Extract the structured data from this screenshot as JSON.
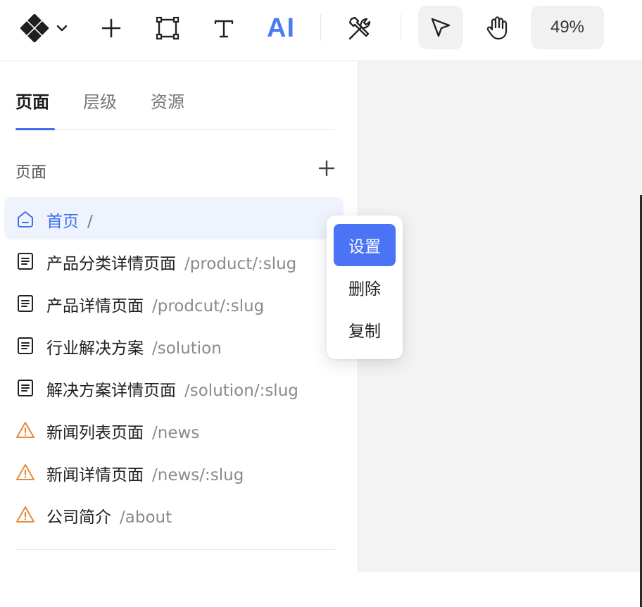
{
  "toolbar": {
    "ai_label": "AI",
    "zoom": "49%",
    "active_tool": "select",
    "icons": [
      "logo-icon",
      "chevron-down-icon",
      "plus-icon",
      "frame-icon",
      "text-icon",
      "tools-icon",
      "pointer-icon",
      "hand-icon"
    ]
  },
  "sidebar": {
    "tabs": [
      {
        "label": "页面",
        "active": true
      },
      {
        "label": "层级",
        "active": false
      },
      {
        "label": "资源",
        "active": false
      }
    ],
    "section_title": "页面",
    "pages": [
      {
        "name": "首页",
        "path": "/",
        "icon": "home-icon",
        "selected": true
      },
      {
        "name": "产品分类详情页面",
        "path": "/product/:slug",
        "icon": "document-icon"
      },
      {
        "name": "产品详情页面",
        "path": "/prodcut/:slug",
        "icon": "document-icon"
      },
      {
        "name": "行业解决方案",
        "path": "/solution",
        "icon": "document-icon"
      },
      {
        "name": "解决方案详情页面",
        "path": "/solution/:slug",
        "icon": "document-icon"
      },
      {
        "name": "新闻列表页面",
        "path": "/news",
        "icon": "warning-icon"
      },
      {
        "name": "新闻详情页面",
        "path": "/news/:slug",
        "icon": "warning-icon"
      },
      {
        "name": "公司简介",
        "path": "/about",
        "icon": "warning-icon"
      }
    ]
  },
  "context_menu": {
    "items": [
      {
        "label": "设置",
        "active": true
      },
      {
        "label": "删除",
        "active": false
      },
      {
        "label": "复制",
        "active": false
      }
    ]
  },
  "colors": {
    "accent": "#3f6ff0",
    "menu_active": "#4a74f5",
    "warning": "#e58a3a",
    "selected_row_bg": "#eff3fd",
    "canvas_bg": "#f3f3f4"
  }
}
